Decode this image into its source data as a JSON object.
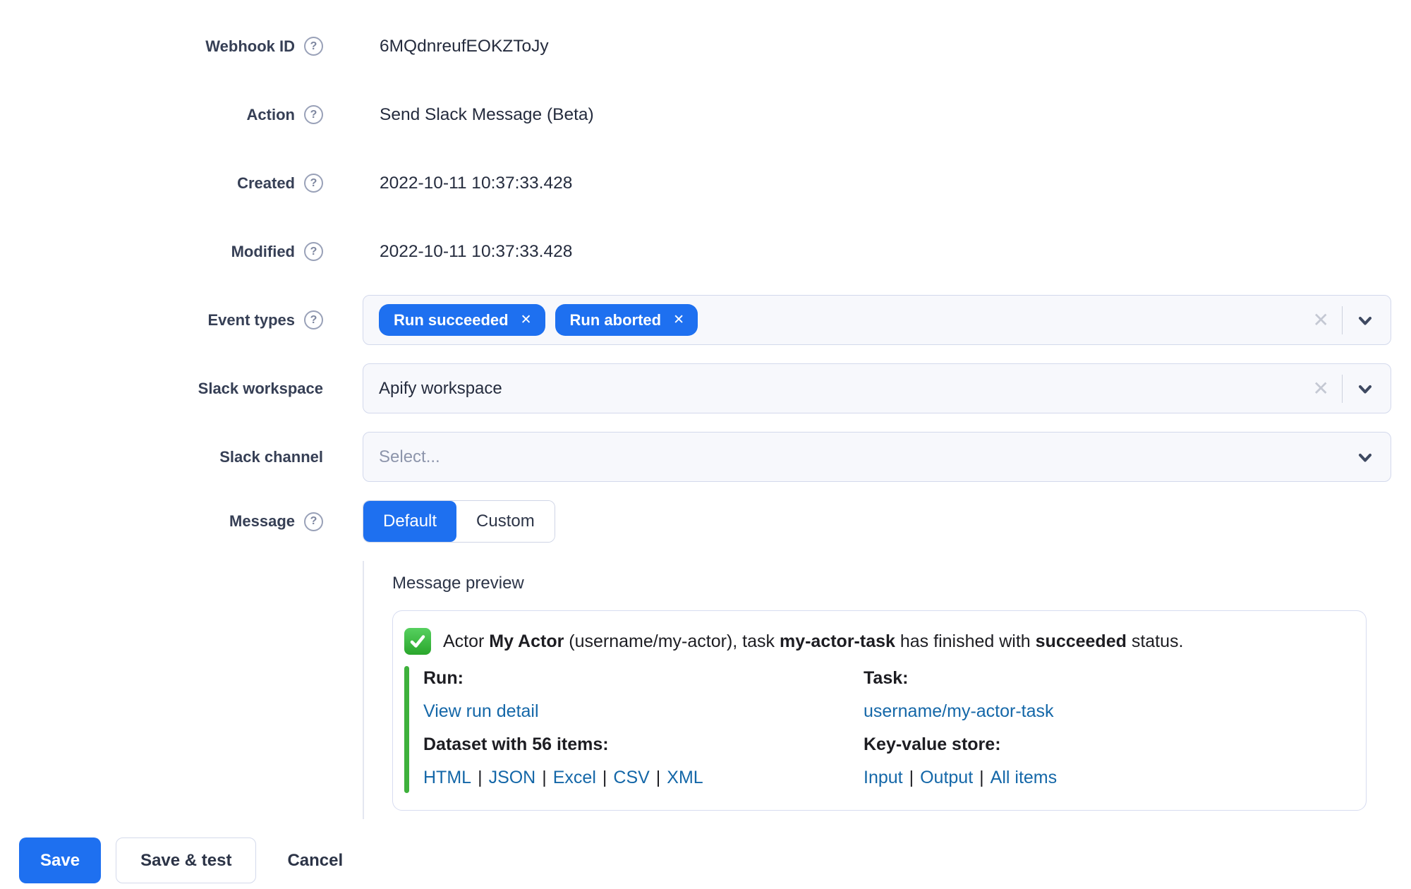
{
  "ui": {
    "help_glyph": "?",
    "clear_glyph": "✕",
    "tag_remove_glyph": "✕",
    "link_separator": "|"
  },
  "colors": {
    "primary_blue": "#1e70f0",
    "link_blue": "#1467a8",
    "attachment_green": "#3eb13c",
    "text_dark": "#252c3e",
    "field_background": "#f7f8fc",
    "border": "#d3d9ec"
  },
  "form": {
    "static_rows": [
      {
        "label": "Webhook ID",
        "value": "6MQdnreufEOKZToJy"
      },
      {
        "label": "Action",
        "value": "Send Slack Message (Beta)"
      },
      {
        "label": "Created",
        "value": "2022-10-11 10:37:33.428"
      },
      {
        "label": "Modified",
        "value": "2022-10-11 10:37:33.428"
      }
    ],
    "event_types": {
      "label": "Event types",
      "tags": [
        "Run succeeded",
        "Run aborted"
      ]
    },
    "slack_workspace": {
      "label": "Slack workspace",
      "value": "Apify workspace"
    },
    "slack_channel": {
      "label": "Slack channel",
      "placeholder": "Select..."
    },
    "message": {
      "label": "Message",
      "options": [
        "Default",
        "Custom"
      ],
      "selected": "Default"
    }
  },
  "preview": {
    "heading": "Message preview",
    "emoji": "white-check-mark",
    "title": [
      {
        "text": "Actor "
      },
      {
        "text": "My Actor",
        "bold": true
      },
      {
        "text": " (username/my-actor), task "
      },
      {
        "text": "my-actor-task",
        "bold": true
      },
      {
        "text": " has finished with "
      },
      {
        "text": "succeeded",
        "bold": true
      },
      {
        "text": " status."
      }
    ],
    "fields": [
      {
        "title": "Run:",
        "links": [
          "View run detail"
        ]
      },
      {
        "title": "Task:",
        "links": [
          "username/my-actor-task"
        ]
      },
      {
        "title": "Dataset with 56 items:",
        "links": [
          "HTML",
          "JSON",
          "Excel",
          "CSV",
          "XML"
        ]
      },
      {
        "title": "Key-value store:",
        "links": [
          "Input",
          "Output",
          "All items"
        ]
      }
    ]
  },
  "actions": {
    "save": "Save",
    "save_and_test": "Save & test",
    "cancel": "Cancel"
  }
}
